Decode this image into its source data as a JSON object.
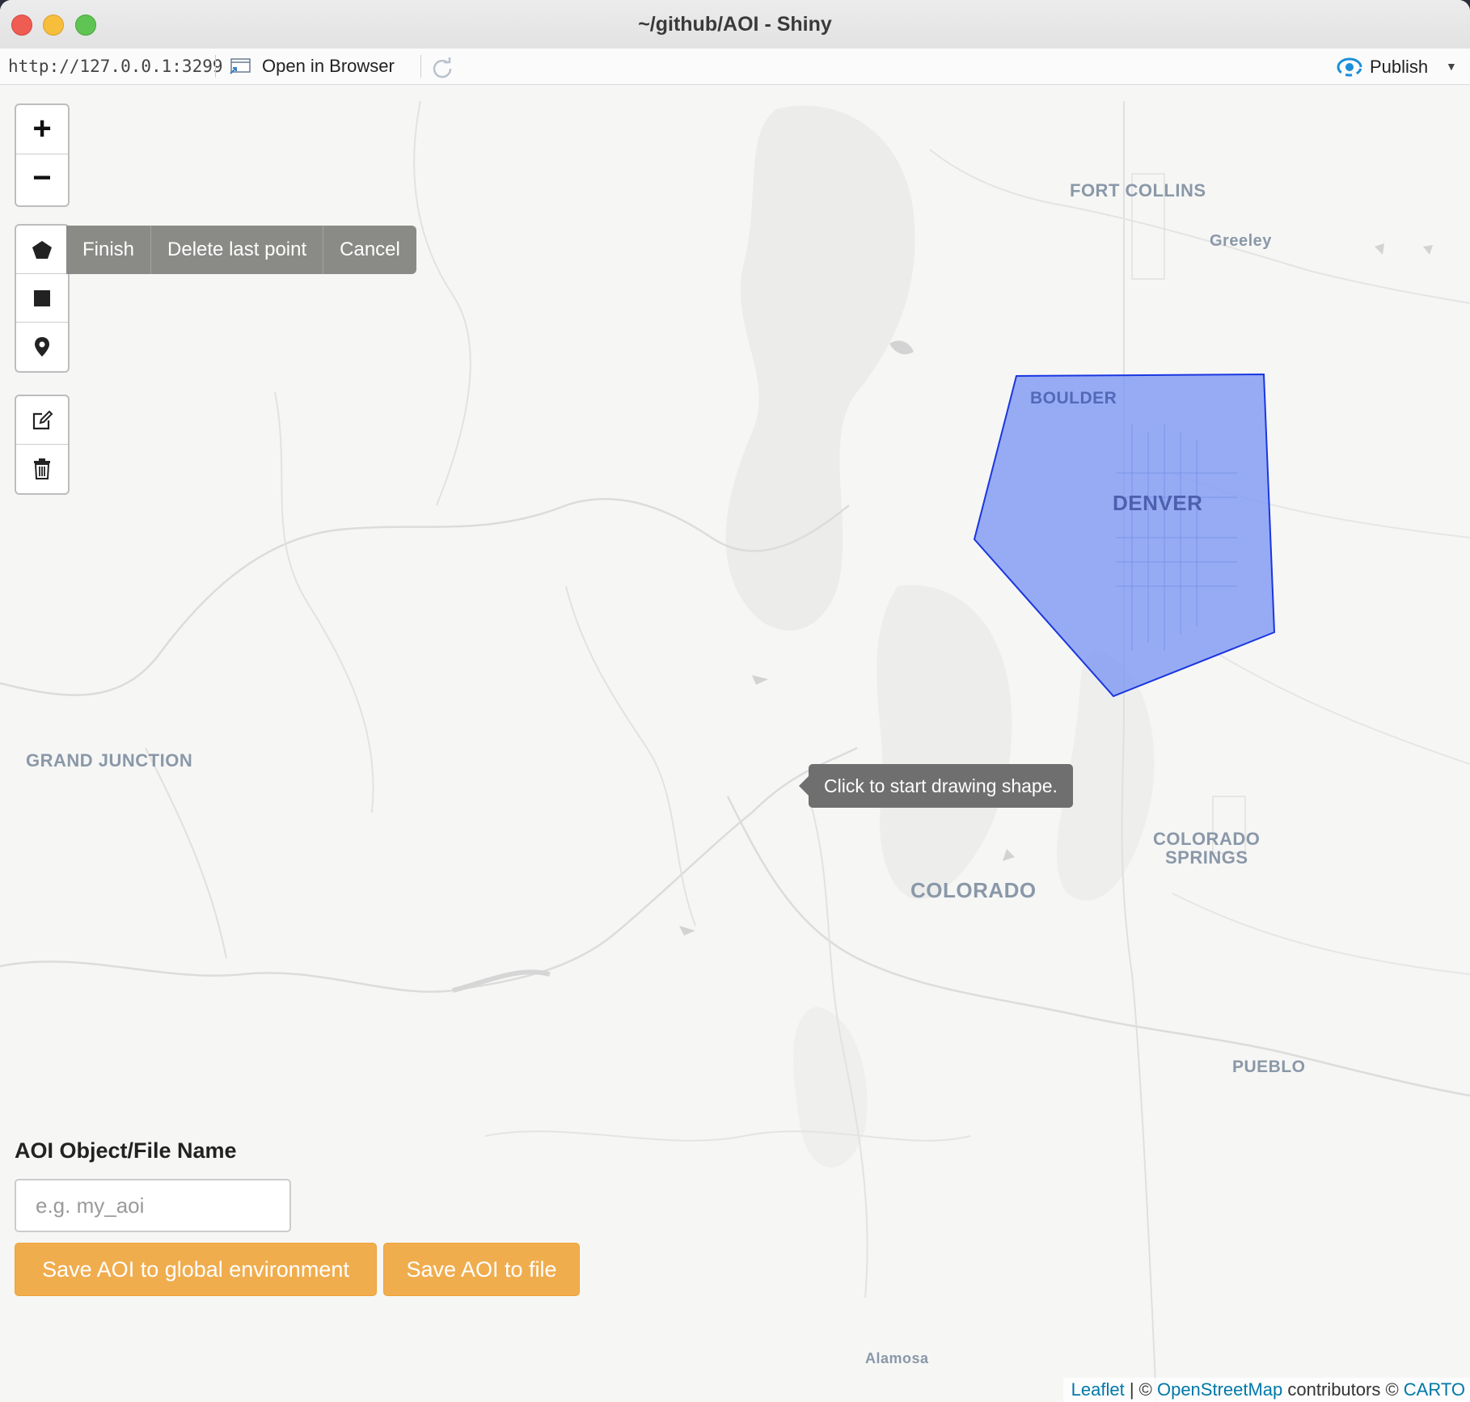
{
  "window": {
    "title": "~/github/AOI - Shiny"
  },
  "toolbar": {
    "url": "http://127.0.0.1:3299",
    "open_in_browser": "Open in Browser",
    "publish": "Publish"
  },
  "map": {
    "zoom_in": "+",
    "zoom_out": "−",
    "draw_actions": {
      "finish": "Finish",
      "delete_last": "Delete last point",
      "cancel": "Cancel"
    },
    "tooltip": "Click to start drawing shape.",
    "places": {
      "fort_collins": "FORT COLLINS",
      "greeley": "Greeley",
      "boulder": "BOULDER",
      "denver": "DENVER",
      "grand_junction": "GRAND JUNCTION",
      "colorado_springs_1": "COLORADO",
      "colorado_springs_2": "SPRINGS",
      "colorado": "COLORADO",
      "pueblo": "PUEBLO",
      "alamosa": "Alamosa"
    },
    "polygon": {
      "fill": "#7b96f4",
      "stroke": "#1a36e0"
    },
    "attribution": {
      "leaflet": "Leaflet",
      "sep": " | © ",
      "osm": "OpenStreetMap",
      "contributors": " contributors © ",
      "carto": "CARTO"
    }
  },
  "form": {
    "label": "AOI Object/File Name",
    "placeholder": "e.g. my_aoi",
    "save_global": "Save AOI to global environment",
    "save_file": "Save AOI to file"
  },
  "colors": {
    "accent_button": "#f0ad4e",
    "link": "#0078a8",
    "publish_icon": "#1b8ed8"
  }
}
